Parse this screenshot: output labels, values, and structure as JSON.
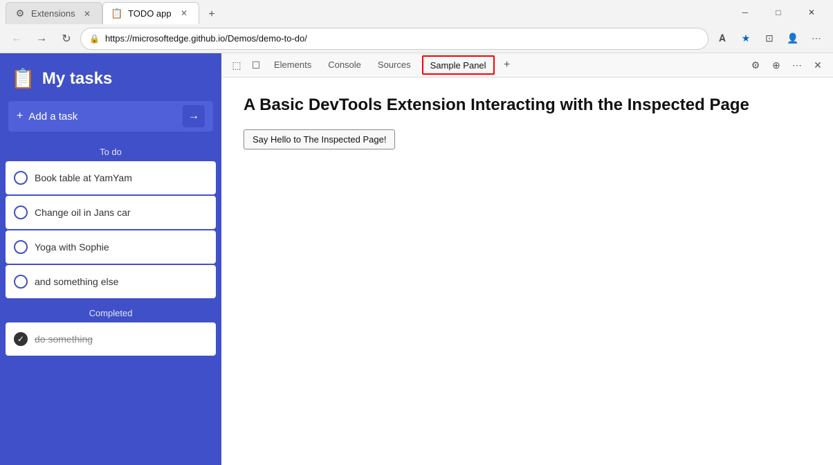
{
  "browser": {
    "tabs": [
      {
        "id": "extensions",
        "icon": "⚙",
        "label": "Extensions",
        "active": false,
        "closeable": true
      },
      {
        "id": "todo-app",
        "icon": "📋",
        "label": "TODO app",
        "active": true,
        "closeable": true
      }
    ],
    "new_tab_label": "+",
    "window_controls": {
      "minimize": "─",
      "maximize": "□",
      "close": "✕"
    },
    "address": {
      "url": "https://microsoftedge.github.io/Demos/demo-to-do/",
      "lock_icon": "🔒"
    },
    "nav": {
      "back": "←",
      "forward": "→",
      "refresh": "↻"
    }
  },
  "todo_app": {
    "title": "My tasks",
    "header_icon": "📋",
    "add_task_placeholder": "Add a task",
    "add_task_arrow": "→",
    "sections": {
      "todo_label": "To do",
      "completed_label": "Completed"
    },
    "todo_items": [
      {
        "text": "Book table at YamYam",
        "done": false
      },
      {
        "text": "Change oil in Jans car",
        "done": false
      },
      {
        "text": "Yoga with Sophie",
        "done": false
      },
      {
        "text": "and something else",
        "done": false
      }
    ],
    "completed_items": [
      {
        "text": "do something",
        "done": true
      }
    ]
  },
  "devtools": {
    "toolbar": {
      "inspect_icon": "⬚",
      "device_icon": "☐",
      "tabs": [
        {
          "label": "Elements",
          "active": false
        },
        {
          "label": "Console",
          "active": false
        },
        {
          "label": "Sources",
          "active": false
        },
        {
          "label": "Sample Panel",
          "active": true
        }
      ],
      "add_tab": "+",
      "settings_icon": "⚙",
      "connect_icon": "⊕",
      "more_icon": "⋯",
      "close_icon": "✕"
    },
    "content": {
      "heading": "A Basic DevTools Extension Interacting with the Inspected Page",
      "button_label": "Say Hello to The Inspected Page!"
    }
  }
}
